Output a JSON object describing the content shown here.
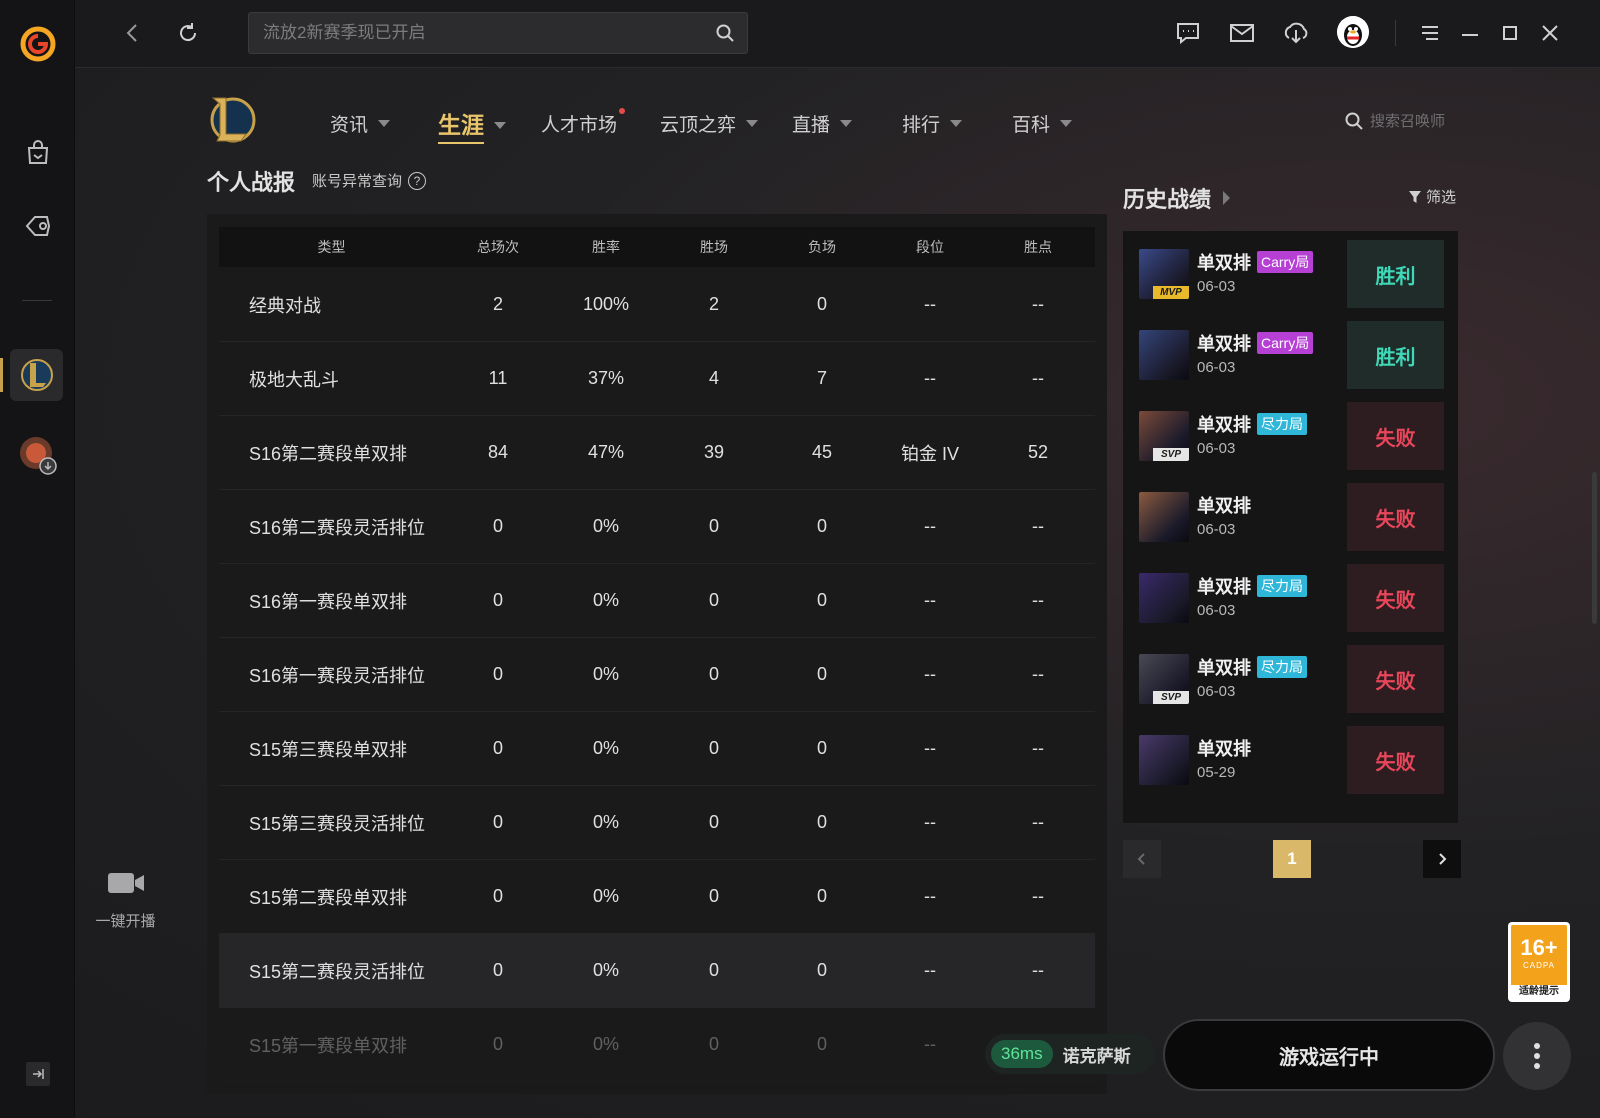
{
  "topbar": {
    "search_placeholder": "流放2新赛季现已开启"
  },
  "game_nav": {
    "items": [
      {
        "label": "资讯",
        "caret": true
      },
      {
        "label": "生涯",
        "caret": true,
        "active": true
      },
      {
        "label": "人才市场",
        "dot": true
      },
      {
        "label": "云顶之弈",
        "caret": true
      },
      {
        "label": "直播",
        "caret": true
      },
      {
        "label": "排行",
        "caret": true
      },
      {
        "label": "百科",
        "caret": true
      }
    ],
    "search_placeholder": "搜索召唤师"
  },
  "personal": {
    "title": "个人战报",
    "link": "账号异常查询",
    "columns": [
      "类型",
      "总场次",
      "胜率",
      "胜场",
      "负场",
      "段位",
      "胜点"
    ],
    "rows": [
      [
        "经典对战",
        "2",
        "100%",
        "2",
        "0",
        "--",
        "--"
      ],
      [
        "极地大乱斗",
        "11",
        "37%",
        "4",
        "7",
        "--",
        "--"
      ],
      [
        "S16第二赛段单双排",
        "84",
        "47%",
        "39",
        "45",
        "铂金 IV",
        "52"
      ],
      [
        "S16第二赛段灵活排位",
        "0",
        "0%",
        "0",
        "0",
        "--",
        "--"
      ],
      [
        "S16第一赛段单双排",
        "0",
        "0%",
        "0",
        "0",
        "--",
        "--"
      ],
      [
        "S16第一赛段灵活排位",
        "0",
        "0%",
        "0",
        "0",
        "--",
        "--"
      ],
      [
        "S15第三赛段单双排",
        "0",
        "0%",
        "0",
        "0",
        "--",
        "--"
      ],
      [
        "S15第三赛段灵活排位",
        "0",
        "0%",
        "0",
        "0",
        "--",
        "--"
      ],
      [
        "S15第二赛段单双排",
        "0",
        "0%",
        "0",
        "0",
        "--",
        "--"
      ],
      [
        "S15第二赛段灵活排位",
        "0",
        "0%",
        "0",
        "0",
        "--",
        "--"
      ],
      [
        "S15第一赛段单双排",
        "0",
        "0%",
        "0",
        "0",
        "--",
        "--"
      ]
    ]
  },
  "history": {
    "title": "历史战绩",
    "filter": "筛选",
    "matches": [
      {
        "mode": "单双排",
        "tag": "Carry局",
        "tag_type": "carry",
        "date": "06-03",
        "result": "胜利",
        "win": true,
        "badge": "MVP",
        "color": "#3a4a8a"
      },
      {
        "mode": "单双排",
        "tag": "Carry局",
        "tag_type": "carry",
        "date": "06-03",
        "result": "胜利",
        "win": true,
        "badge": "",
        "color": "#34457a"
      },
      {
        "mode": "单双排",
        "tag": "尽力局",
        "tag_type": "effort",
        "date": "06-03",
        "result": "失败",
        "win": false,
        "badge": "SVP",
        "color": "#7a4a3a"
      },
      {
        "mode": "单双排",
        "tag": "",
        "tag_type": "",
        "date": "06-03",
        "result": "失败",
        "win": false,
        "badge": "",
        "color": "#8a5a40"
      },
      {
        "mode": "单双排",
        "tag": "尽力局",
        "tag_type": "effort",
        "date": "06-03",
        "result": "失败",
        "win": false,
        "badge": "",
        "color": "#3a2a6a"
      },
      {
        "mode": "单双排",
        "tag": "尽力局",
        "tag_type": "effort",
        "date": "06-03",
        "result": "失败",
        "win": false,
        "badge": "SVP",
        "color": "#4a4a55"
      },
      {
        "mode": "单双排",
        "tag": "",
        "tag_type": "",
        "date": "05-29",
        "result": "失败",
        "win": false,
        "badge": "",
        "color": "#4a3a6a"
      }
    ],
    "page": "1"
  },
  "stream": {
    "label": "一键开播"
  },
  "bottom": {
    "ping": "36ms",
    "server": "诺克萨斯",
    "run_button": "游戏运行中"
  },
  "age_rating": {
    "number": "16+",
    "org": "CADPA",
    "text": "适龄提示"
  },
  "colors": {
    "accent": "#e8c46a",
    "win": "#3fd9b8",
    "lose": "#e8465a"
  }
}
